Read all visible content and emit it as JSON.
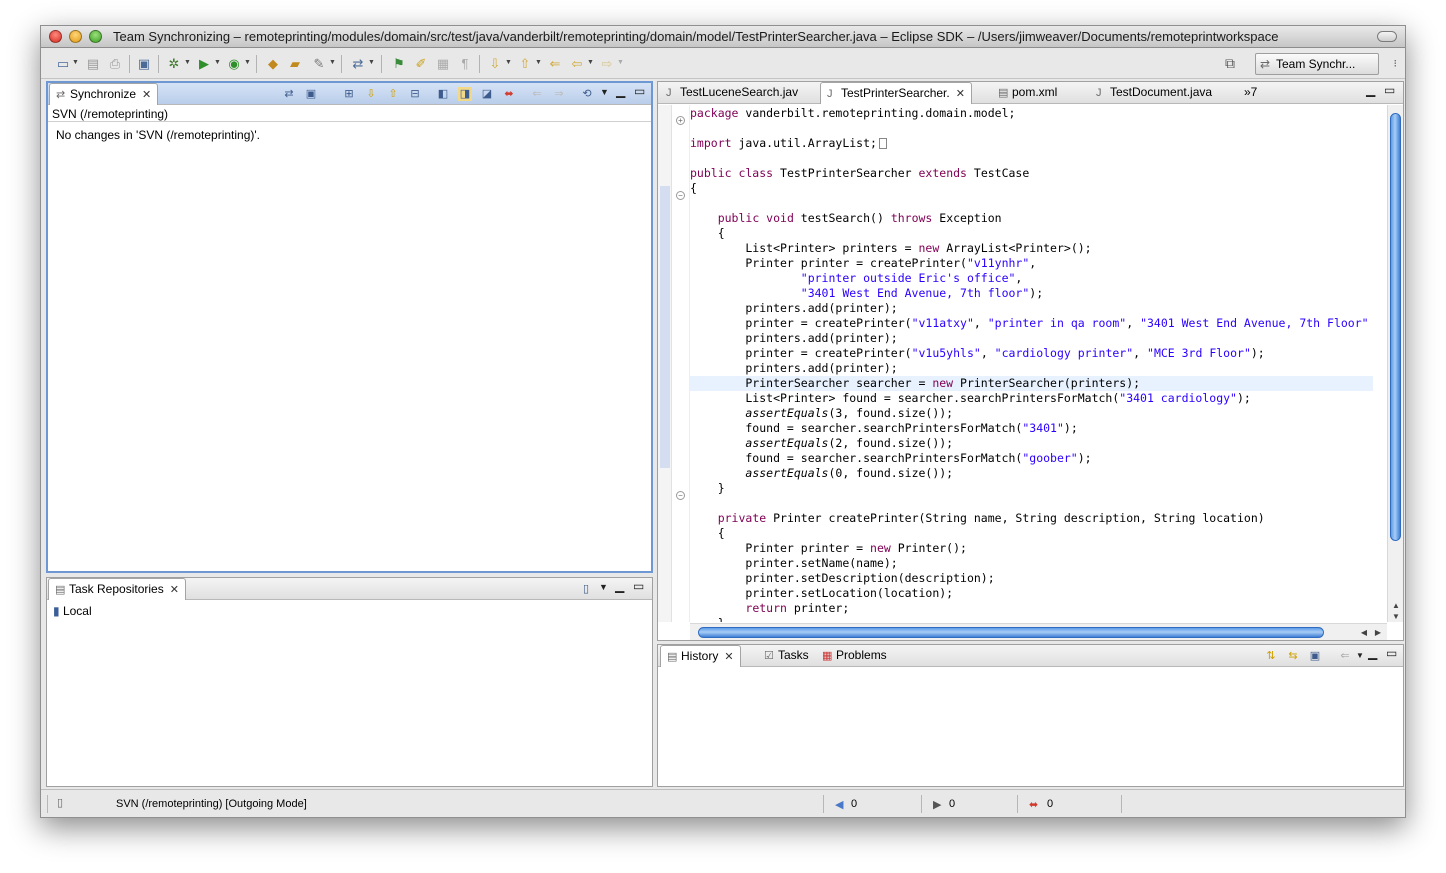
{
  "window": {
    "title": "Team Synchronizing – remoteprinting/modules/domain/src/test/java/vanderbilt/remoteprinting/domain/model/TestPrinterSearcher.java – Eclipse SDK – /Users/jimweaver/Documents/remoteprintworkspace"
  },
  "toolbar": {
    "perspective_label": "Team Synchr...",
    "icons": [
      "new-icon",
      "save-icon",
      "print-icon",
      "binary-icon",
      "debug-icon",
      "run-icon",
      "external-tools-icon",
      "open-type-icon",
      "open-resource-icon",
      "search-icon",
      "team-sync-icon",
      "marker-icon",
      "annotation-icon",
      "whitespace-icon",
      "next-annotation-icon",
      "prev-annotation-icon",
      "back-icon",
      "forward-icon"
    ]
  },
  "synchronize_view": {
    "tab_label": "Synchronize",
    "header": "SVN (/remoteprinting)",
    "message": "No changes in 'SVN (/remoteprinting)'."
  },
  "task_repositories_view": {
    "tab_label": "Task Repositories",
    "items": [
      "Local"
    ]
  },
  "editor": {
    "tabs": [
      {
        "label": "TestLuceneSearch.jav",
        "selected": false
      },
      {
        "label": "TestPrinterSearcher.",
        "selected": true
      },
      {
        "label": "pom.xml",
        "selected": false
      },
      {
        "label": "TestDocument.java",
        "selected": false
      }
    ],
    "overflow_label": "»7",
    "code_lines": [
      "package vanderbilt.remoteprinting.domain.model;",
      "",
      "import java.util.ArrayList;",
      "",
      "public class TestPrinterSearcher extends TestCase",
      "{",
      "",
      "    public void testSearch() throws Exception",
      "    {",
      "        List<Printer> printers = new ArrayList<Printer>();",
      "        Printer printer = createPrinter(\"v11ynhr\",",
      "                \"printer outside Eric's office\",",
      "                \"3401 West End Avenue, 7th floor\");",
      "        printers.add(printer);",
      "        printer = createPrinter(\"v11atxy\", \"printer in qa room\", \"3401 West End Avenue, 7th Floor\"",
      "        printers.add(printer);",
      "        printer = createPrinter(\"v1u5yhls\", \"cardiology printer\", \"MCE 3rd Floor\");",
      "        printers.add(printer);",
      "        PrinterSearcher searcher = new PrinterSearcher(printers);",
      "        List<Printer> found = searcher.searchPrintersForMatch(\"3401 cardiology\");",
      "        assertEquals(3, found.size());",
      "        found = searcher.searchPrintersForMatch(\"3401\");",
      "        assertEquals(2, found.size());",
      "        found = searcher.searchPrintersForMatch(\"goober\");",
      "        assertEquals(0, found.size());",
      "    }",
      "",
      "    private Printer createPrinter(String name, String description, String location)",
      "    {",
      "        Printer printer = new Printer();",
      "        printer.setName(name);",
      "        printer.setDescription(description);",
      "        printer.setLocation(location);",
      "        return printer;",
      "    }"
    ]
  },
  "bottom_view": {
    "tabs": [
      {
        "label": "History",
        "selected": true
      },
      {
        "label": "Tasks",
        "selected": false
      },
      {
        "label": "Problems",
        "selected": false
      }
    ]
  },
  "statusbar": {
    "text": "SVN (/remoteprinting) [Outgoing Mode]",
    "incoming": "0",
    "outgoing": "0",
    "conflicting": "0"
  },
  "colors": {
    "keyword": "#7f0055",
    "string": "#2a00ff",
    "active_border": "#6e98d4",
    "conflict": "#d23b2e"
  }
}
